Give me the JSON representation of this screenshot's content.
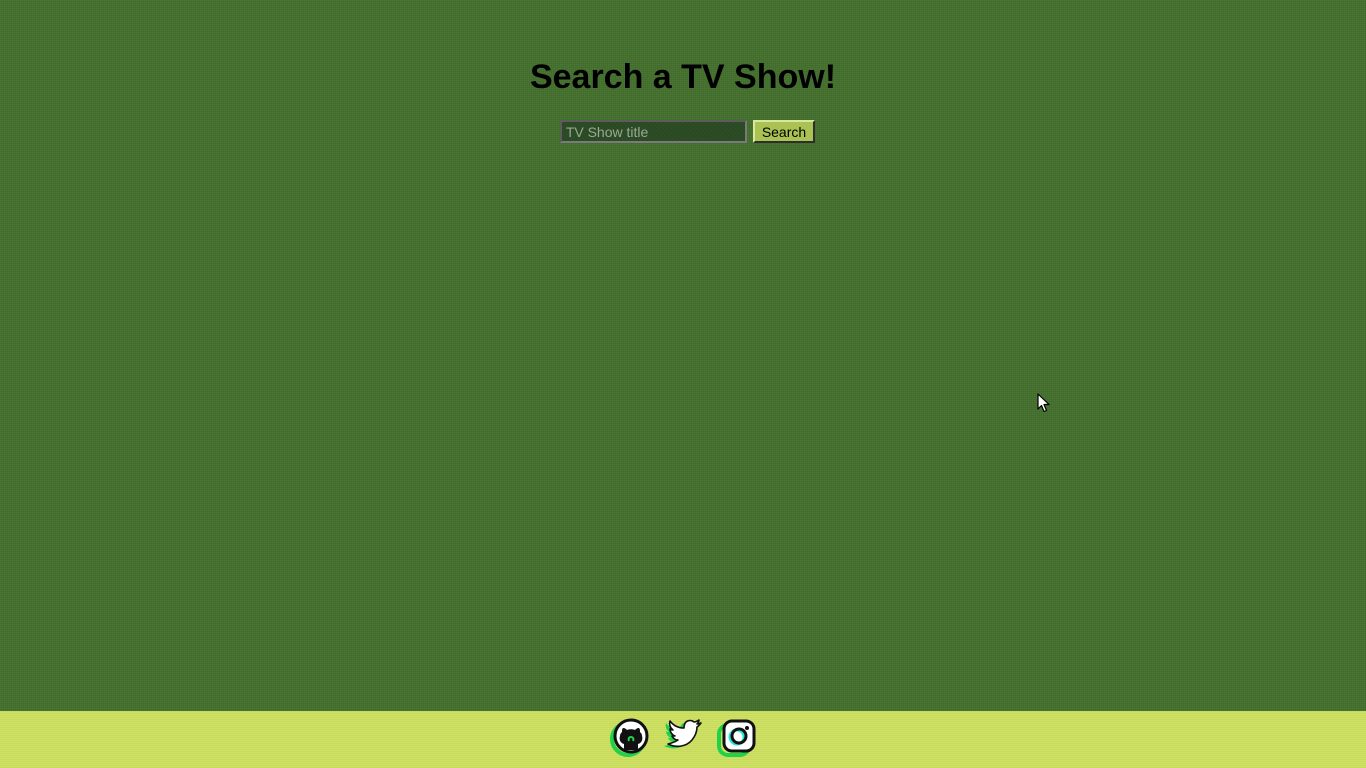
{
  "header": {
    "title": "Search a TV Show!"
  },
  "search": {
    "placeholder": "TV Show title",
    "value": "",
    "button_label": "Search"
  },
  "footer": {
    "social_links": [
      {
        "icon": "github-icon"
      },
      {
        "icon": "twitter-icon"
      },
      {
        "icon": "instagram-icon"
      }
    ]
  },
  "colors": {
    "background": "#44712e",
    "footer_background": "#cfe263",
    "button_background": "#a9c253",
    "input_background": "#2d4d26",
    "icon_accent_green": "#1fd24a",
    "icon_accent_cyan": "#25e6d8"
  }
}
